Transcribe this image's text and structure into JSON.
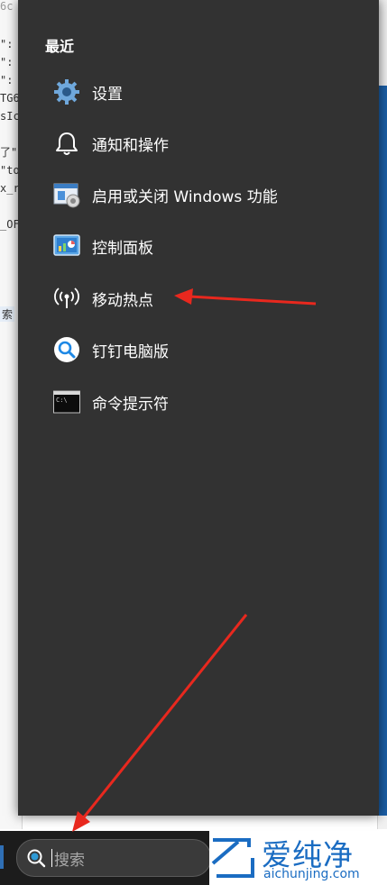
{
  "background_editor": {
    "lines": [
      "6c",
      "\":",
      "\":",
      "\":",
      "TG6",
      "sIc",
      "了\"",
      "\"to",
      "x_r",
      "_OF",
      "索"
    ]
  },
  "panel": {
    "title": "最近",
    "items": [
      {
        "label": "设置",
        "icon": "settings-gear-icon"
      },
      {
        "label": "通知和操作",
        "icon": "notification-bell-icon"
      },
      {
        "label": "启用或关闭 Windows 功能",
        "icon": "windows-features-icon"
      },
      {
        "label": "控制面板",
        "icon": "control-panel-icon"
      },
      {
        "label": "移动热点",
        "icon": "mobile-hotspot-icon"
      },
      {
        "label": "钉钉电脑版",
        "icon": "dingtalk-icon"
      },
      {
        "label": "命令提示符",
        "icon": "command-prompt-icon"
      }
    ]
  },
  "taskbar": {
    "search_placeholder": "搜索"
  },
  "watermark": {
    "brand_cn": "爱纯净",
    "url": "aichunjing.com"
  },
  "colors": {
    "panel_bg": "#323232",
    "taskbar_bg": "#1c1c1c",
    "accent": "#1b5fa7",
    "arrow": "#e8281e",
    "watermark": "#1a6cc2"
  }
}
